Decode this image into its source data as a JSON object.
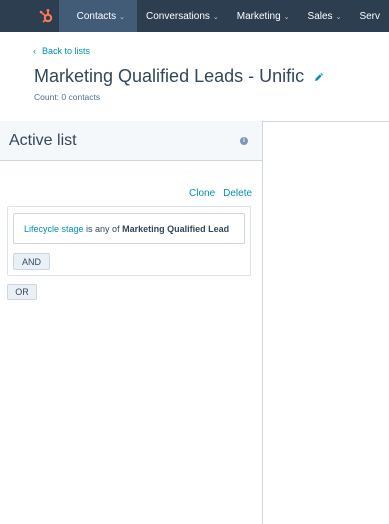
{
  "nav": {
    "logo_icon": "hubspot-sprocket-icon",
    "items": [
      {
        "label": "Contacts",
        "active": true
      },
      {
        "label": "Conversations",
        "active": false
      },
      {
        "label": "Marketing",
        "active": false
      },
      {
        "label": "Sales",
        "active": false
      },
      {
        "label": "Serv",
        "active": false
      }
    ]
  },
  "header": {
    "back_label": "Back to lists",
    "title": "Marketing Qualified Leads - Unific",
    "count": "Count: 0 contacts"
  },
  "panel": {
    "title": "Active list",
    "clone_label": "Clone",
    "delete_label": "Delete",
    "filter": {
      "property": "Lifecycle stage",
      "operator": " is any of ",
      "value": "Marketing Qualified Lead"
    },
    "and_label": "AND",
    "or_label": "OR"
  },
  "colors": {
    "nav_bg": "#2d3e50",
    "nav_active": "#425b76",
    "link": "#0091ae",
    "logo": "#ff7a59"
  }
}
